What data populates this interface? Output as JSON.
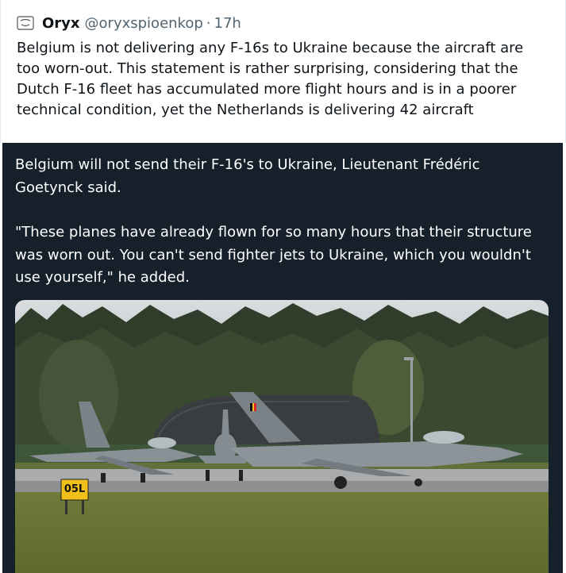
{
  "tweet": {
    "author_name": "Oryx",
    "handle": "@oryxspioenkop",
    "separator": "·",
    "time": "17h",
    "text": "Belgium is not delivering any F-16s to Ukraine because the aircraft are too worn-out. This statement is rather surprising, considering that the Dutch F-16 fleet has accumulated more flight hours and is in a poorer technical condition, yet the Netherlands is delivering 42 aircraft"
  },
  "embedded": {
    "paragraph1": "Belgium will not send their F-16's to Ukraine, Lieutenant Frédéric Goetynck said.",
    "paragraph2": "\"These planes have already flown for so many hours that their structure was worn out. You can't send fighter jets to Ukraine, which you wouldn't use yourself,\" he added.",
    "runway_sign": "05L"
  },
  "colors": {
    "media_bg": "#15202b",
    "text_primary": "#0f1419",
    "text_secondary": "#536471",
    "sign_yellow": "#f2c01a"
  }
}
